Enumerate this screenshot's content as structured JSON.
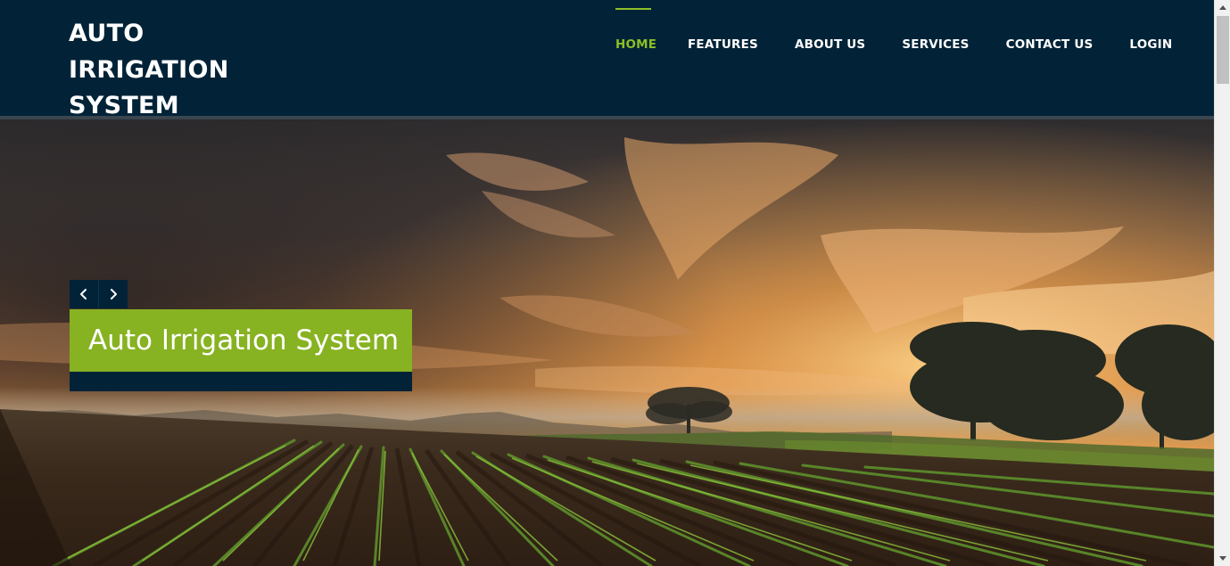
{
  "brand": {
    "line1": "AUTO",
    "line2": "IRRIGATION",
    "line3": "SYSTEM"
  },
  "nav": {
    "items": [
      {
        "label": "HOME",
        "active": true
      },
      {
        "label": "FEATURES",
        "active": false
      },
      {
        "label": "ABOUT US",
        "active": false
      },
      {
        "label": "SERVICES",
        "active": false
      },
      {
        "label": "CONTACT US",
        "active": false
      },
      {
        "label": "LOGIN",
        "active": false
      }
    ]
  },
  "hero": {
    "image": "sunset-farm-field",
    "caption": "Auto Irrigation System",
    "prev_icon": "chevron-left-icon",
    "next_icon": "chevron-right-icon"
  },
  "colors": {
    "header_bg": "#022337",
    "accent": "#8cbf26",
    "caption_bg": "#87b222"
  }
}
